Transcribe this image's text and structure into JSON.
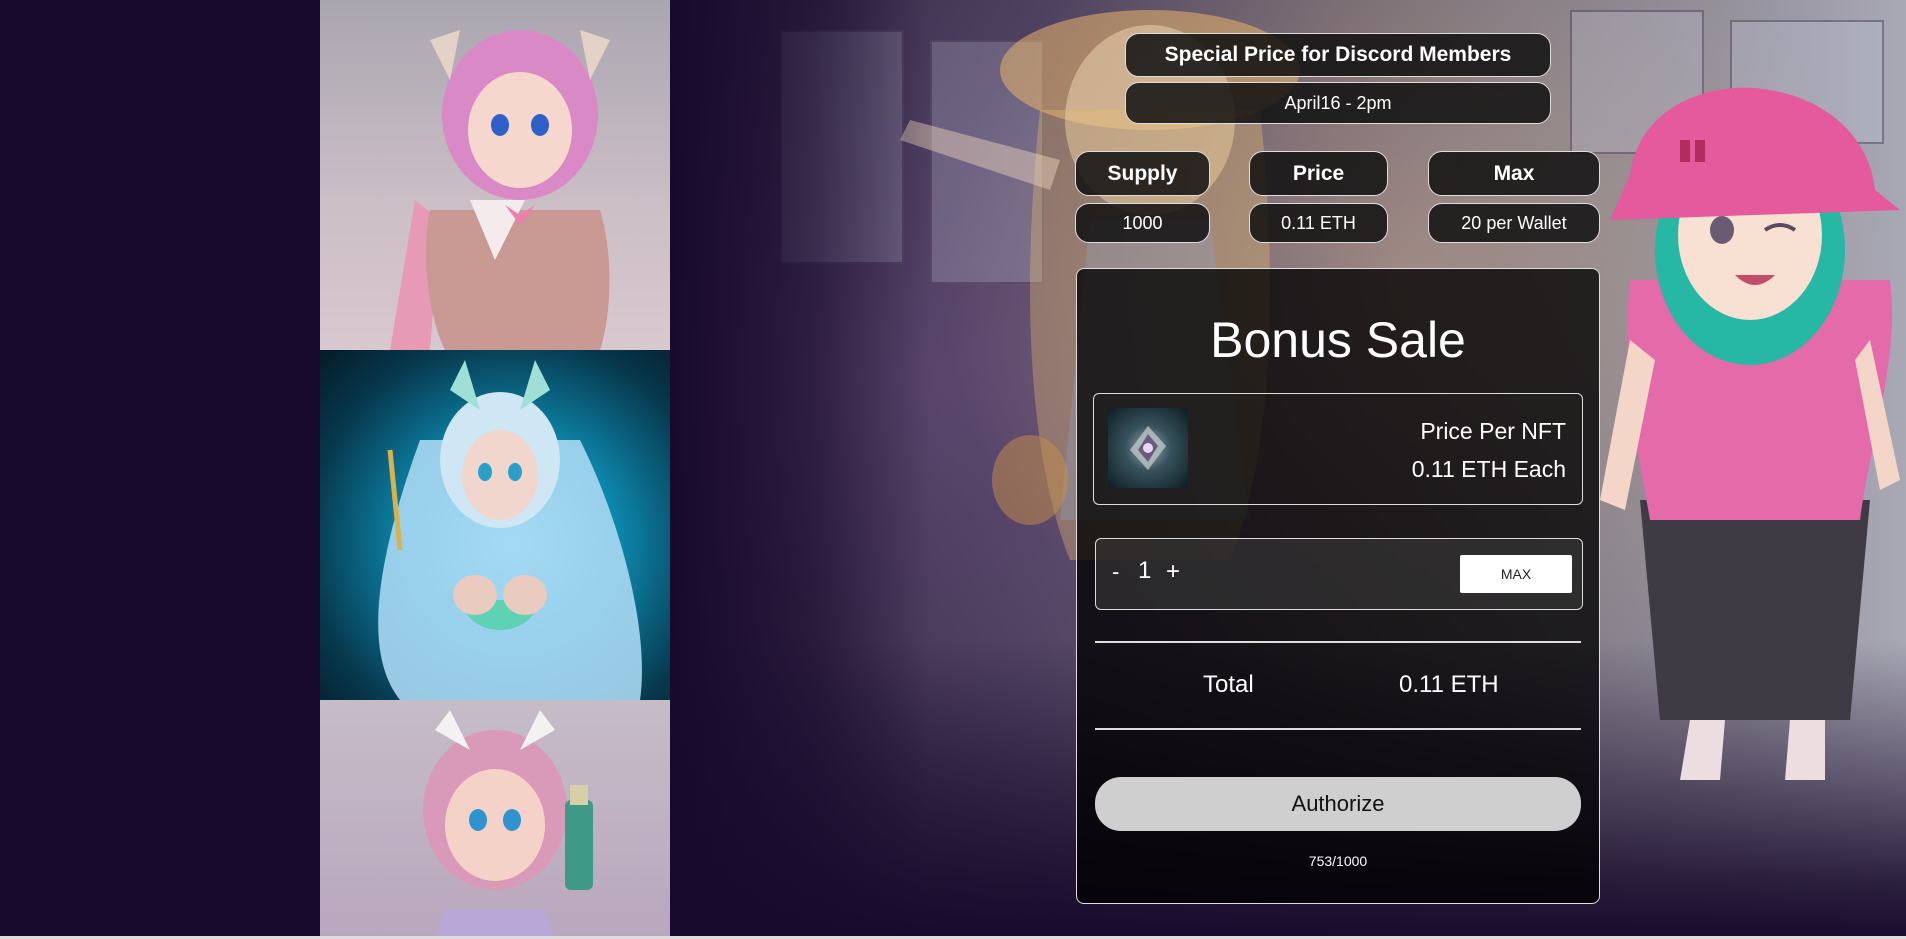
{
  "banner": {
    "title": "Special Price for Discord Members",
    "date": "April16 - 2pm"
  },
  "stats": [
    {
      "label": "Supply",
      "value": "1000"
    },
    {
      "label": "Price",
      "value": "0.11 ETH"
    },
    {
      "label": "Max",
      "value": "20 per Wallet"
    }
  ],
  "sale": {
    "title": "Bonus Sale",
    "price_label": "Price Per NFT",
    "price_value": "0.11 ETH Each",
    "quantity": "1",
    "minus_label": "-",
    "plus_label": "+",
    "max_label": "MAX",
    "total_label": "Total",
    "total_value": "0.11 ETH",
    "authorize_label": "Authorize",
    "minted": "753/1000"
  },
  "colors": {
    "page_bg": "#180a2c",
    "panel_bg": "#0f0f0f",
    "border": "#dddddd",
    "authorize_bg": "#cfcfcf"
  }
}
